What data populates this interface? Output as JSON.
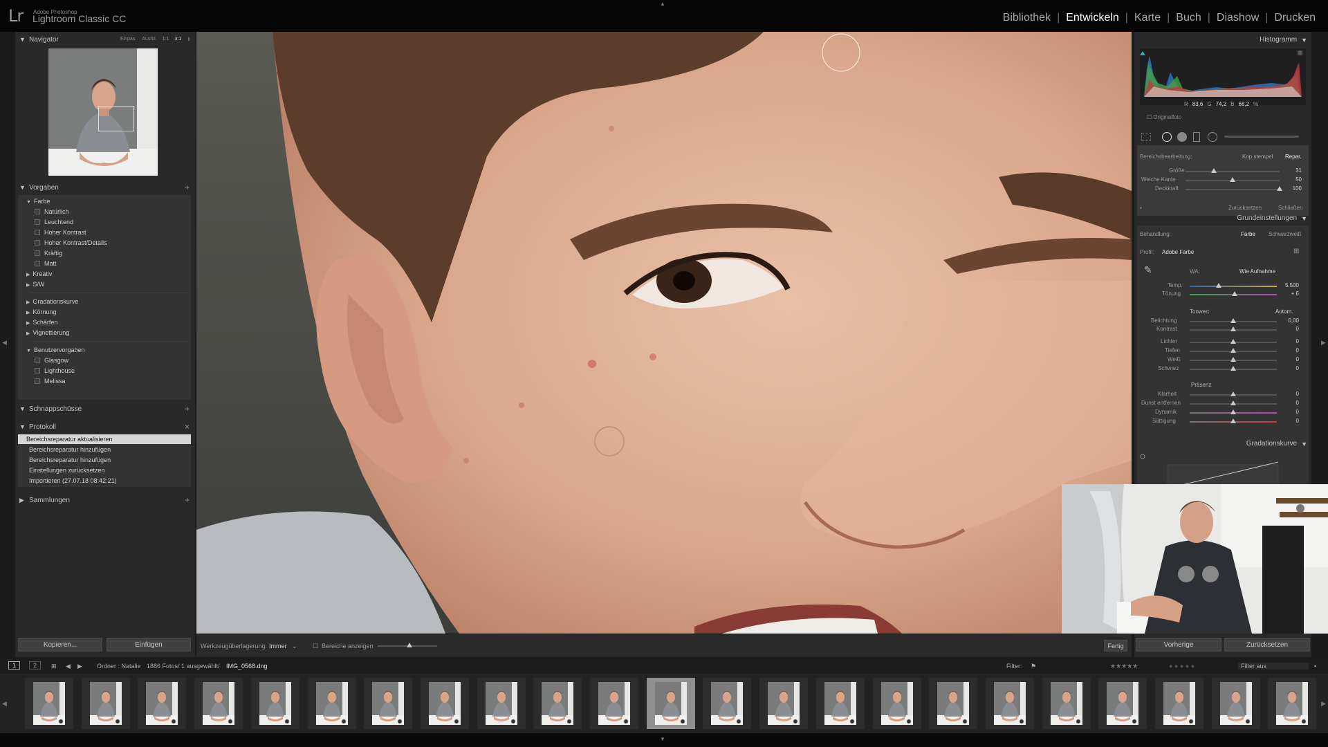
{
  "app": {
    "logo_mark": "Lr",
    "logo_sub": "Adobe Photoshop",
    "logo_name": "Lightroom Classic CC"
  },
  "modules": [
    "Bibliothek",
    "Entwickeln",
    "Karte",
    "Buch",
    "Diashow",
    "Drucken"
  ],
  "active_module": "Entwickeln",
  "left": {
    "navigator": {
      "title": "Navigator",
      "zoom_options": [
        "Einpas.",
        "Ausfül.",
        "1:1",
        "3:1"
      ],
      "active_zoom": "3:1"
    },
    "presets": {
      "title": "Vorgaben",
      "groups": [
        {
          "label": "Farbe",
          "expanded": true,
          "items": [
            "Natürlich",
            "Leuchtend",
            "Hoher Kontrast",
            "Hoher Kontrast/Details",
            "Kräftig",
            "Matt"
          ]
        },
        {
          "label": "Kreativ",
          "expanded": false,
          "items": []
        },
        {
          "label": "S/W",
          "expanded": false,
          "items": []
        }
      ],
      "groups2": [
        "Gradationskurve",
        "Körnung",
        "Schärfen",
        "Vignettierung"
      ],
      "user_group": {
        "label": "Benutzervorgaben",
        "items": [
          "Glasgow",
          "Lighthouse",
          "Melissa"
        ]
      }
    },
    "snapshots": {
      "title": "Schnappschüsse"
    },
    "history": {
      "title": "Protokoll",
      "items": [
        "Bereichsreparatur aktualisieren",
        "Bereichsreparatur hinzufügen",
        "Bereichsreparatur hinzufügen",
        "Einstellungen zurücksetzen",
        "Importieren (27.07.18 08:42:21)"
      ]
    },
    "collections": {
      "title": "Sammlungen"
    },
    "copy_button": "Kopieren...",
    "paste_button": "Einfügen"
  },
  "toolbar": {
    "overlay_label": "Werkzeugüberlagerung:",
    "overlay_value": "Immer",
    "show_areas": "Bereiche anzeigen",
    "done_button": "Fertig"
  },
  "right": {
    "histogram": {
      "title": "Histogramm",
      "r_label": "R",
      "r": "83,6",
      "g_label": "G",
      "g": "74,2",
      "b_label": "B",
      "b": "68,2",
      "unit": "%",
      "original_label": "Originalfoto"
    },
    "spot_removal": {
      "title": "Bereichsbearbeitung:",
      "modes": [
        "Kop.stempel",
        "Repar."
      ],
      "active_mode": "Repar.",
      "sliders": [
        {
          "label": "Größe",
          "value": "31",
          "pos": 0.3
        },
        {
          "label": "Weiche Kante",
          "value": "50",
          "pos": 0.5
        },
        {
          "label": "Deckkraft",
          "value": "100",
          "pos": 1.0
        }
      ],
      "reset": "Zurücksetzen",
      "close": "Schließen"
    },
    "basic": {
      "title": "Grundeinstellungen",
      "treatment_label": "Behandlung:",
      "treatment_options": [
        "Farbe",
        "Schwarzweiß"
      ],
      "profile_label": "Profil:",
      "profile_value": "Adobe Farbe",
      "wb_label": "WA:",
      "wb_value": "Wie Aufnahme",
      "wb_sliders": [
        {
          "label": "Temp.",
          "value": "5.500",
          "pos": 0.33
        },
        {
          "label": "Tönung",
          "value": "+ 6",
          "pos": 0.52
        }
      ],
      "tone_label": "Tonwert",
      "auto_label": "Autom.",
      "tone_sliders": [
        {
          "label": "Belichtung",
          "value": "0,00",
          "pos": 0.5
        },
        {
          "label": "Kontrast",
          "value": "0",
          "pos": 0.5
        },
        {
          "label": "Lichter",
          "value": "0",
          "pos": 0.5
        },
        {
          "label": "Tiefen",
          "value": "0",
          "pos": 0.5
        },
        {
          "label": "Weiß",
          "value": "0",
          "pos": 0.5
        },
        {
          "label": "Schwarz",
          "value": "0",
          "pos": 0.5
        }
      ],
      "presence_label": "Präsenz",
      "presence_sliders": [
        {
          "label": "Klarheit",
          "value": "0",
          "pos": 0.5
        },
        {
          "label": "Dunst entfernen",
          "value": "0",
          "pos": 0.5
        },
        {
          "label": "Dynamik",
          "value": "0",
          "pos": 0.5
        },
        {
          "label": "Sättigung",
          "value": "0",
          "pos": 0.5
        }
      ]
    },
    "curve": {
      "title": "Gradationskurve"
    },
    "prev_button": "Vorherige",
    "reset_button": "Zurücksetzen"
  },
  "filmbar": {
    "page1": "1",
    "page2": "2",
    "path_prefix": "Ordner : Natalie",
    "count": "1886 Fotos/ 1 ausgewählt/",
    "filename": "IMG_0568.dng",
    "filter_label": "Filter:",
    "filter_value": "Filter aus"
  },
  "filmstrip": {
    "count": 23,
    "selected_index": 11
  },
  "colors": {
    "accent_active": "#ffffff",
    "panel": "#292929",
    "background": "#1b1b1b"
  }
}
